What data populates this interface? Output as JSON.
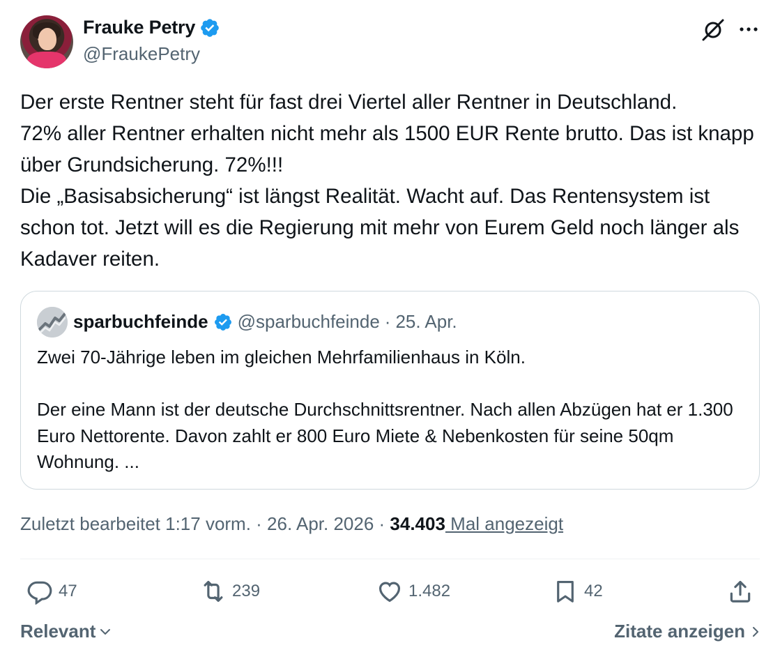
{
  "author": {
    "display_name": "Frauke Petry",
    "handle": "@FraukePetry",
    "verified": true
  },
  "header_icons": {
    "grok": "grok-icon",
    "more": "more-icon"
  },
  "tweet": {
    "text": "Der erste Rentner steht für fast drei Viertel aller Rentner in Deutschland.\n72% aller Rentner erhalten nicht mehr als 1500 EUR Rente brutto. Das ist knapp über Grundsicherung. 72%!!!\nDie „Basisabsicherung“ ist längst Realität. Wacht auf. Das Rentensystem ist schon tot. Jetzt will es die Regierung mit mehr von Eurem Geld noch länger als Kadaver reiten."
  },
  "quote": {
    "display_name": "sparbuchfeinde",
    "handle": "@sparbuchfeinde",
    "separator": "·",
    "date": "25. Apr.",
    "text": "Zwei 70-Jährige leben im gleichen Mehrfamilienhaus in Köln.\n\nDer eine Mann ist der deutsche Durchschnittsrentner. Nach allen Abzügen hat er 1.300 Euro Nettorente. Davon zahlt er 800 Euro Miete & Nebenkosten für seine 50qm Wohnung. ..."
  },
  "meta": {
    "edited": "Zuletzt bearbeitet 1:17 vorm. · 26. Apr. 2026 · ",
    "views_count": "34.403",
    "views_label": " Mal angezeigt"
  },
  "actions": {
    "replies": "47",
    "reposts": "239",
    "likes": "1.482",
    "bookmarks": "42"
  },
  "footer": {
    "sort_label": "Relevant",
    "quotes_link": "Zitate anzeigen"
  },
  "colors": {
    "text": "#0f1419",
    "secondary": "#536471",
    "verified": "#1d9bf0",
    "border": "#cfd9de"
  }
}
